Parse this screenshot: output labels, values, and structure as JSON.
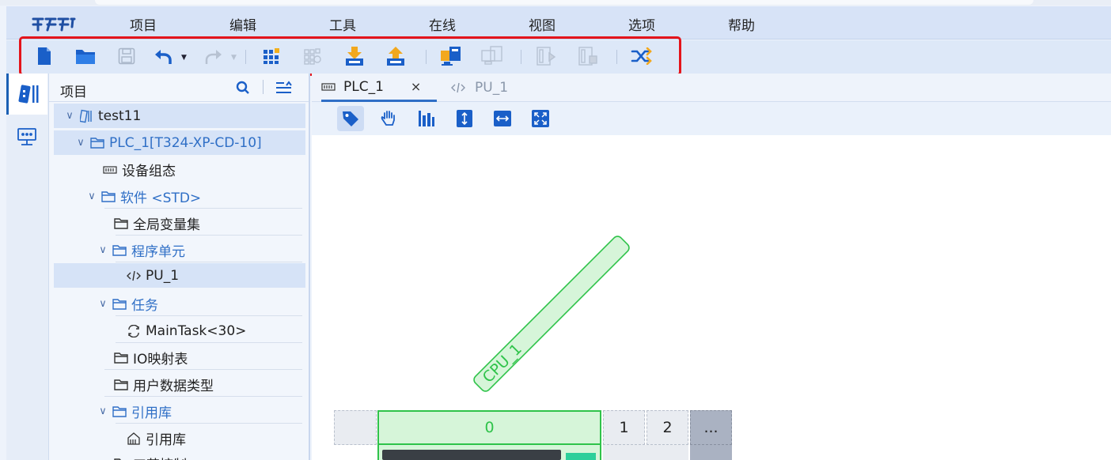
{
  "menu": {
    "items": [
      "项目",
      "编辑",
      "工具",
      "在线",
      "视图",
      "选项",
      "帮助"
    ]
  },
  "toolbar": {
    "buttons": [
      {
        "icon": "new-file-icon",
        "enabled": true
      },
      {
        "icon": "open-folder-icon",
        "enabled": true
      },
      {
        "icon": "save-icon",
        "enabled": false
      },
      {
        "icon": "undo-icon",
        "enabled": true
      },
      {
        "icon": "redo-icon",
        "enabled": false
      },
      {
        "icon": "compile-icon",
        "enabled": true
      },
      {
        "icon": "compile-all-icon",
        "enabled": false
      },
      {
        "icon": "download-icon",
        "enabled": true
      },
      {
        "icon": "upload-icon",
        "enabled": true
      },
      {
        "icon": "go-online-icon",
        "enabled": true
      },
      {
        "icon": "go-offline-icon",
        "enabled": false
      },
      {
        "icon": "run-icon",
        "enabled": false
      },
      {
        "icon": "stop-icon",
        "enabled": false
      },
      {
        "icon": "shuffle-icon",
        "enabled": true
      }
    ]
  },
  "panel": {
    "title": "项目"
  },
  "tree": [
    {
      "label": "test11",
      "icon": "project-icon",
      "expanded": true
    },
    {
      "label": "PLC_1[T324-XP-CD-10]",
      "icon": "folder-icon",
      "expanded": true
    },
    {
      "label": "设备组态",
      "icon": "device-icon"
    },
    {
      "label": "软件 <STD>",
      "icon": "folder-icon",
      "expanded": true
    },
    {
      "label": "全局变量集",
      "icon": "folder-icon"
    },
    {
      "label": "程序单元",
      "icon": "folder-icon",
      "expanded": true
    },
    {
      "label": "PU_1",
      "icon": "code-icon",
      "selected": true
    },
    {
      "label": "任务",
      "icon": "folder-icon",
      "expanded": true
    },
    {
      "label": "MainTask<30>",
      "icon": "cycle-icon"
    },
    {
      "label": "IO映射表",
      "icon": "folder-icon"
    },
    {
      "label": "用户数据类型",
      "icon": "folder-icon"
    },
    {
      "label": "引用库",
      "icon": "folder-icon",
      "expanded": true
    },
    {
      "label": "引用库",
      "icon": "library-icon"
    },
    {
      "label": "工艺控制",
      "icon": "folder-icon"
    }
  ],
  "tabs": [
    {
      "label": "PLC_1",
      "icon": "device-icon",
      "active": true,
      "close": "×"
    },
    {
      "label": "PU_1",
      "icon": "code-icon",
      "active": false
    }
  ],
  "canvas": {
    "cpu_label": "CPU_1",
    "slots": [
      "0",
      "1",
      "2",
      "..."
    ]
  },
  "colors": {
    "accent": "#2f6fc6",
    "highlight_border": "#e4141b",
    "cpu_green": "#2fc34a",
    "cpu_fill": "#d6f5d9"
  }
}
